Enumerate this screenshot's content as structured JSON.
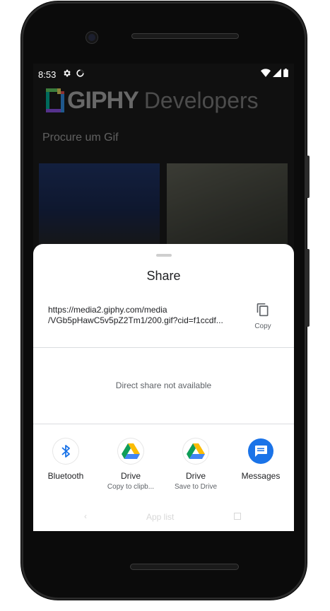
{
  "status_bar": {
    "time": "8:53",
    "icons_left": [
      "gear-icon",
      "data-saver-icon"
    ],
    "icons_right": [
      "wifi-icon",
      "cellular-icon",
      "battery-icon"
    ]
  },
  "app": {
    "logo_text": "GIPHY",
    "logo_suffix": "Developers",
    "search_placeholder": "Procure um Gif"
  },
  "share_sheet": {
    "title": "Share",
    "url_line1": "https://media2.giphy.com/media",
    "url_line2": "/VGb5pHawC5v5pZ2Tm1/200.gif?cid=f1ccdf...",
    "copy_label": "Copy",
    "direct_share_text": "Direct share not available",
    "targets": [
      {
        "label": "Bluetooth",
        "sub": "",
        "icon": "bluetooth-icon"
      },
      {
        "label": "Drive",
        "sub": "Copy to clipb...",
        "icon": "google-drive-icon"
      },
      {
        "label": "Drive",
        "sub": "Save to Drive",
        "icon": "google-drive-icon"
      },
      {
        "label": "Messages",
        "sub": "",
        "icon": "messages-icon"
      }
    ],
    "bottom_ghost_text": "App list"
  },
  "colors": {
    "bluetooth": "#1a73e8",
    "messages": "#1a73e8",
    "drive_green": "#0f9d58",
    "drive_yellow": "#fbbc04",
    "drive_blue": "#4285f4"
  }
}
